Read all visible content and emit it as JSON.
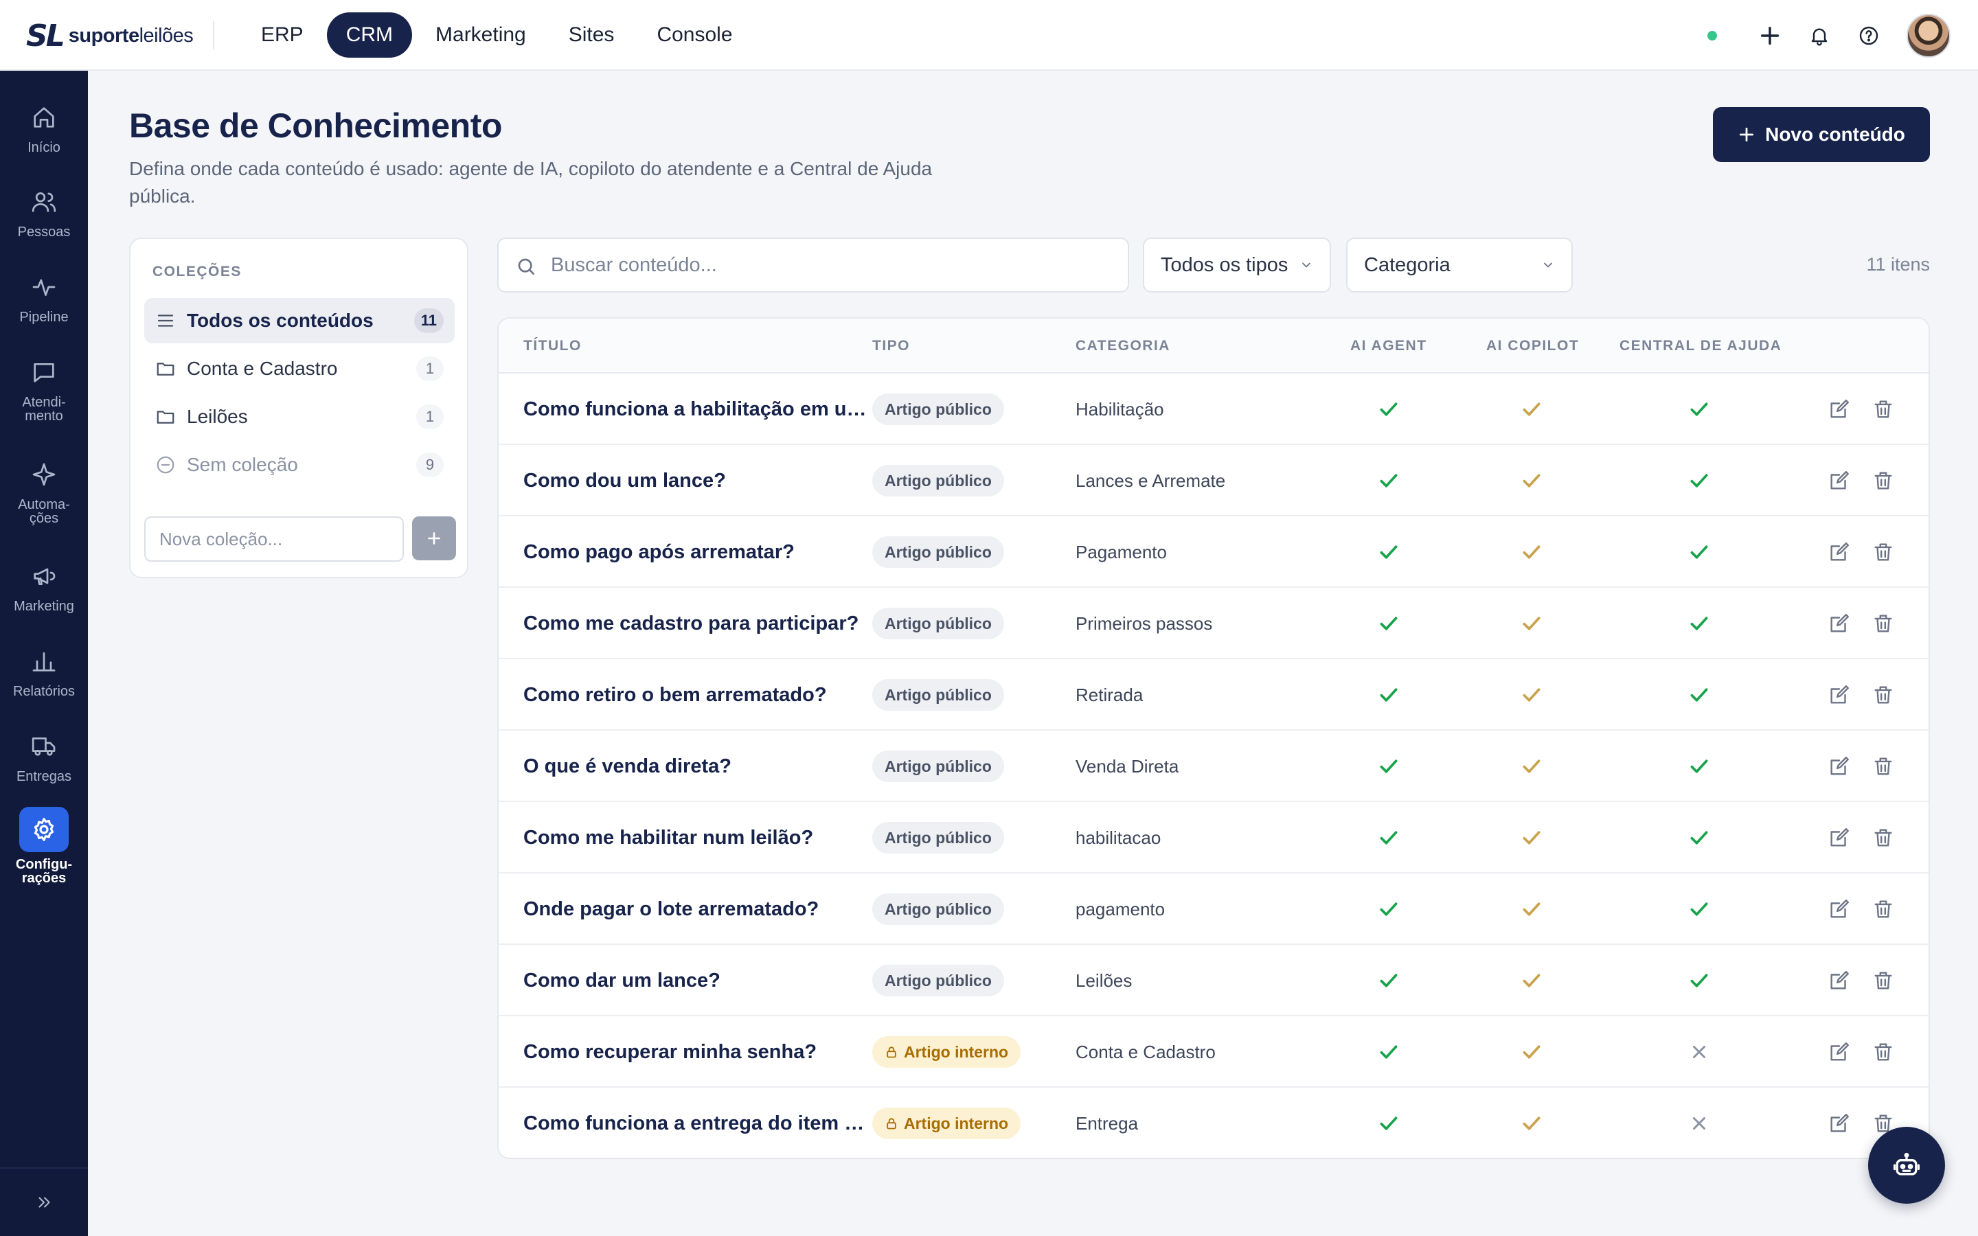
{
  "brand": {
    "mark": "SL",
    "name_bold": "suporte",
    "name_regular": "leilões"
  },
  "topnav": [
    {
      "label": "ERP",
      "active": false
    },
    {
      "label": "CRM",
      "active": true
    },
    {
      "label": "Marketing",
      "active": false
    },
    {
      "label": "Sites",
      "active": false
    },
    {
      "label": "Console",
      "active": false
    }
  ],
  "sidebar": {
    "items": [
      {
        "label": "Início",
        "icon": "home-icon"
      },
      {
        "label": "Pessoas",
        "icon": "users-icon"
      },
      {
        "label": "Pipeline",
        "icon": "pulse-icon"
      },
      {
        "label": "Atendi-\nmento",
        "icon": "chat-icon"
      },
      {
        "label": "Automa-\nções",
        "icon": "sparkle-icon"
      },
      {
        "label": "Marketing",
        "icon": "megaphone-icon"
      },
      {
        "label": "Relatórios",
        "icon": "bar-chart-icon"
      },
      {
        "label": "Entregas",
        "icon": "truck-icon"
      },
      {
        "label": "Configu-\nrações",
        "icon": "gear-icon",
        "active": true
      }
    ]
  },
  "header": {
    "title": "Base de Conhecimento",
    "subtitle": "Defina onde cada conteúdo é usado: agente de IA, copiloto do atendente e a Central de Ajuda pública.",
    "new_button": "Novo conteúdo"
  },
  "collections": {
    "title": "COLEÇÕES",
    "items": [
      {
        "label": "Todos os conteúdos",
        "count": "11",
        "icon": "list-icon",
        "active": true
      },
      {
        "label": "Conta e Cadastro",
        "count": "1",
        "icon": "folder-icon"
      },
      {
        "label": "Leilões",
        "count": "1",
        "icon": "folder-icon"
      },
      {
        "label": "Sem coleção",
        "count": "9",
        "icon": "minus-circle-icon",
        "muted": true
      }
    ],
    "new_placeholder": "Nova coleção..."
  },
  "filters": {
    "search_placeholder": "Buscar conteúdo...",
    "type_select": "Todos os tipos",
    "category_select": "Categoria",
    "count_text": "11 itens"
  },
  "table": {
    "columns": [
      "TÍTULO",
      "TIPO",
      "CATEGORIA",
      "AI AGENT",
      "AI COPILOT",
      "CENTRAL DE AJUDA"
    ],
    "colors": {
      "check": "#16a34a",
      "copilot_check": "#c9a24a",
      "cross": "#8a92a3"
    },
    "rows": [
      {
        "title": "Como funciona a habilitação em um leilão?",
        "type": "Artigo público",
        "internal": false,
        "category": "Habilitação",
        "ai_agent": true,
        "ai_copilot": true,
        "help_center": true
      },
      {
        "title": "Como dou um lance?",
        "type": "Artigo público",
        "internal": false,
        "category": "Lances e Arremate",
        "ai_agent": true,
        "ai_copilot": true,
        "help_center": true
      },
      {
        "title": "Como pago após arrematar?",
        "type": "Artigo público",
        "internal": false,
        "category": "Pagamento",
        "ai_agent": true,
        "ai_copilot": true,
        "help_center": true
      },
      {
        "title": "Como me cadastro para participar?",
        "type": "Artigo público",
        "internal": false,
        "category": "Primeiros passos",
        "ai_agent": true,
        "ai_copilot": true,
        "help_center": true
      },
      {
        "title": "Como retiro o bem arrematado?",
        "type": "Artigo público",
        "internal": false,
        "category": "Retirada",
        "ai_agent": true,
        "ai_copilot": true,
        "help_center": true
      },
      {
        "title": "O que é venda direta?",
        "type": "Artigo público",
        "internal": false,
        "category": "Venda Direta",
        "ai_agent": true,
        "ai_copilot": true,
        "help_center": true
      },
      {
        "title": "Como me habilitar num leilão?",
        "type": "Artigo público",
        "internal": false,
        "category": "habilitacao",
        "ai_agent": true,
        "ai_copilot": true,
        "help_center": true
      },
      {
        "title": "Onde pagar o lote arrematado?",
        "type": "Artigo público",
        "internal": false,
        "category": "pagamento",
        "ai_agent": true,
        "ai_copilot": true,
        "help_center": true
      },
      {
        "title": "Como dar um lance?",
        "type": "Artigo público",
        "internal": false,
        "category": "Leilões",
        "ai_agent": true,
        "ai_copilot": true,
        "help_center": true
      },
      {
        "title": "Como recuperar minha senha?",
        "type": "Artigo interno",
        "internal": true,
        "category": "Conta e Cadastro",
        "ai_agent": true,
        "ai_copilot": true,
        "help_center": false
      },
      {
        "title": "Como funciona a entrega do item arrematado?",
        "type": "Artigo interno",
        "internal": true,
        "category": "Entrega",
        "ai_agent": true,
        "ai_copilot": true,
        "help_center": false
      }
    ]
  },
  "fab": {
    "icon": "robot-icon"
  }
}
